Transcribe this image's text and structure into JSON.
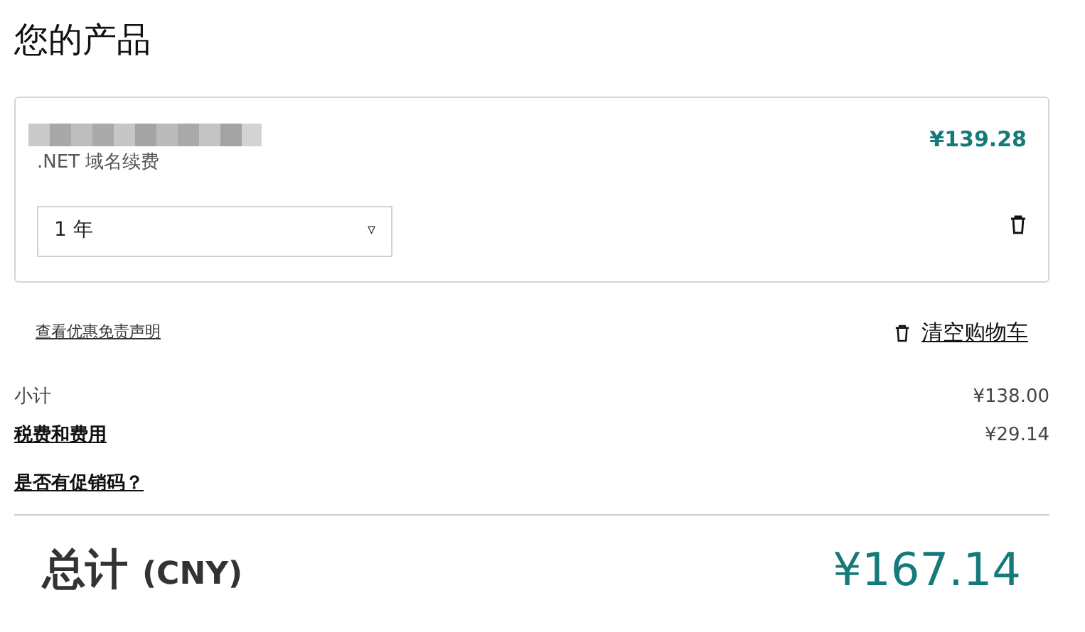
{
  "title": "您的产品",
  "product": {
    "name_redacted": true,
    "description": ".NET 域名续费",
    "price": "¥139.28",
    "term": {
      "value": "1 年",
      "arrow": "▿"
    }
  },
  "links": {
    "disclaimer": "查看优惠免责声明",
    "clear_cart": "清空购物车"
  },
  "summary": [
    {
      "label": "小计",
      "amount": "¥138.00",
      "link": false
    },
    {
      "label": "税费和费用",
      "amount": "¥29.14",
      "link": true
    }
  ],
  "promo": "是否有促销码？",
  "total": {
    "label": "总计",
    "currency": "(CNY)",
    "amount": "¥167.14"
  }
}
